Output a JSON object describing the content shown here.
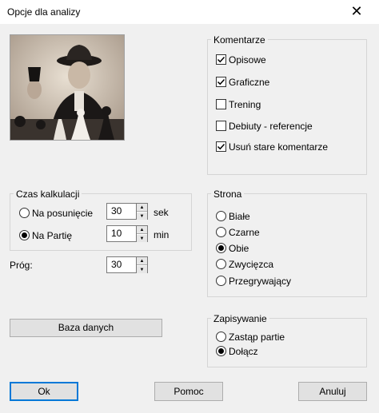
{
  "window": {
    "title": "Opcje dla analizy",
    "close_glyph": "✕"
  },
  "comments": {
    "legend": "Komentarze",
    "items": [
      {
        "label": "Opisowe",
        "checked": true
      },
      {
        "label": "Graficzne",
        "checked": true
      },
      {
        "label": "Trening",
        "checked": false
      },
      {
        "label": "Debiuty - referencje",
        "checked": false
      },
      {
        "label": "Usuń stare komentarze",
        "checked": true
      }
    ]
  },
  "calc": {
    "legend": "Czas kalkulacji",
    "per_move": {
      "label": "Na posunięcie",
      "value": "30",
      "unit": "sek",
      "selected": false
    },
    "per_game": {
      "label": "Na Partię",
      "value": "10",
      "unit": "min",
      "selected": true
    }
  },
  "threshold": {
    "label": "Próg:",
    "value": "30"
  },
  "side": {
    "legend": "Strona",
    "options": [
      {
        "label": "Białe",
        "selected": false
      },
      {
        "label": "Czarne",
        "selected": false
      },
      {
        "label": "Obie",
        "selected": true
      },
      {
        "label": "Zwycięzca",
        "selected": false
      },
      {
        "label": "Przegrywający",
        "selected": false
      }
    ]
  },
  "save": {
    "legend": "Zapisywanie",
    "options": [
      {
        "label": "Zastąp partie",
        "selected": false
      },
      {
        "label": "Dołącz",
        "selected": true
      }
    ]
  },
  "buttons": {
    "database": "Baza danych",
    "ok": "Ok",
    "help": "Pomoc",
    "cancel": "Anuluj"
  },
  "icons": {
    "check": "check-icon",
    "spin_up": "spin-up-icon",
    "spin_down": "spin-down-icon"
  }
}
